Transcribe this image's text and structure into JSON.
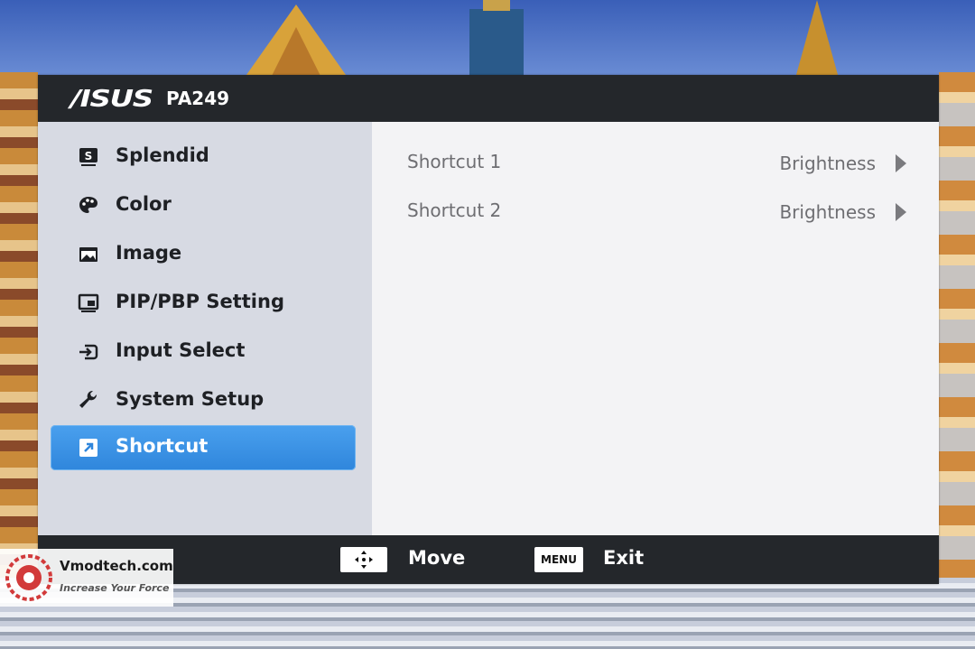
{
  "header": {
    "brand": "/ISUS",
    "model": "PA249"
  },
  "sidebar": {
    "items": [
      {
        "label": "Splendid",
        "icon": "splendid-icon"
      },
      {
        "label": "Color",
        "icon": "palette-icon"
      },
      {
        "label": "Image",
        "icon": "image-icon"
      },
      {
        "label": "PIP/PBP Setting",
        "icon": "pip-icon"
      },
      {
        "label": "Input Select",
        "icon": "input-icon"
      },
      {
        "label": "System Setup",
        "icon": "wrench-icon"
      },
      {
        "label": "Shortcut",
        "icon": "shortcut-icon",
        "selected": true
      }
    ]
  },
  "content": {
    "rows": [
      {
        "label": "Shortcut 1",
        "value": "Brightness"
      },
      {
        "label": "Shortcut 2",
        "value": "Brightness"
      }
    ]
  },
  "footer": {
    "move_label": "Move",
    "menu_key": "MENU",
    "exit_label": "Exit"
  },
  "watermark": {
    "site": "Vmodtech.com",
    "tagline": "Increase Your Force"
  },
  "colors": {
    "accent": "#3a93e6",
    "header_bg": "#24272b",
    "sidebar_bg": "#d7dae3",
    "content_bg": "#f3f3f5"
  }
}
